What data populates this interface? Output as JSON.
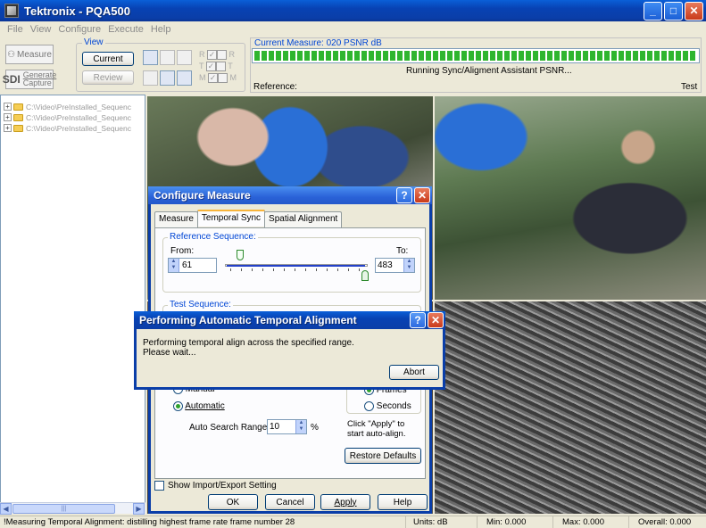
{
  "window": {
    "title": "Tektronix - PQA500",
    "min_glyph": "_",
    "max_glyph": "□",
    "close_glyph": "✕"
  },
  "menu": [
    "File",
    "View",
    "Configure",
    "Execute",
    "Help"
  ],
  "toolbar": {
    "measure_label": "Measure",
    "capture_label": "Generate",
    "capture_sub": "Capture",
    "view_group": "View",
    "current_label": "Current",
    "review_label": "Review",
    "check_labels": [
      "R",
      "T",
      "M"
    ],
    "check_right": [
      "R",
      "T",
      "M"
    ]
  },
  "measure": {
    "current_label": "Current Measure: 020 PSNR dB",
    "status_text": "Running Sync/Aligment Assistant PSNR...",
    "reference_label": "Reference:",
    "test_label": "Test",
    "progress_fraction": 1.0
  },
  "tree": {
    "items": [
      "C:\\Video\\PreInstalled_Sequenc",
      "C:\\Video\\PreInstalled_Sequenc",
      "C:\\Video\\PreInstalled_Sequenc"
    ],
    "scroll_grip": "|||"
  },
  "configure_dialog": {
    "title": "Configure Measure",
    "help_glyph": "?",
    "close_glyph": "✕",
    "tabs": [
      "Measure",
      "Temporal Sync",
      "Spatial Alignment"
    ],
    "reference_sequence": {
      "legend": "Reference Sequence:",
      "from_label": "From:",
      "to_label": "To:",
      "from_value": "61",
      "to_value": "483"
    },
    "test_sequence": {
      "legend": "Test Sequence:"
    },
    "manual_label": "Manual",
    "automatic_label": "Automatic",
    "frames_label": "Frames",
    "seconds_label": "Seconds",
    "auto_search_label": "Auto Search Range ±",
    "auto_search_value": "10",
    "auto_search_unit": "%",
    "apply_hint": "Click \"Apply\" to start auto-align.",
    "restore_defaults": "Restore Defaults",
    "show_import_export": "Show Import/Export Setting",
    "buttons": {
      "ok": "OK",
      "cancel": "Cancel",
      "apply": "Apply",
      "help": "Help"
    }
  },
  "performing_dialog": {
    "title": "Performing Automatic Temporal Alignment",
    "message_line1": "Performing temporal align across the specified range.",
    "message_line2": "Please wait...",
    "abort_label": "Abort",
    "help_glyph": "?",
    "close_glyph": "✕"
  },
  "statusbar": {
    "message": "!Measuring Temporal Alignment: distilling highest frame rate frame number 28",
    "units": "Units: dB",
    "min": "Min: 0.000",
    "max": "Max: 0.000",
    "overall": "Overall: 0.000"
  }
}
